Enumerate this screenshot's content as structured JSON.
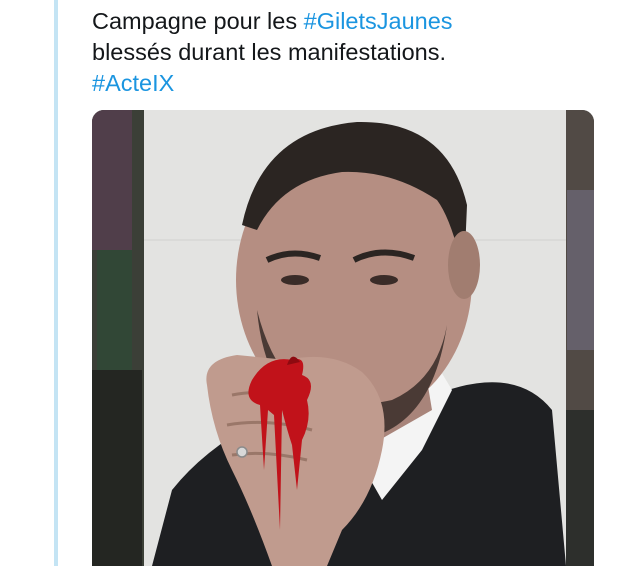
{
  "tweet": {
    "line1_prefix": "Campagne pour les ",
    "line1_hashtag": "#GiletsJaunes",
    "line2": "blessés durant les manifestations.",
    "line3_hashtag": "#ActeIX"
  },
  "colors": {
    "quote_bar": "#c4e4f4",
    "text": "#14171a",
    "hashtag": "#1b95e0",
    "blood": "#c1121a"
  },
  "media": {
    "icon": "photo-poster-image"
  }
}
